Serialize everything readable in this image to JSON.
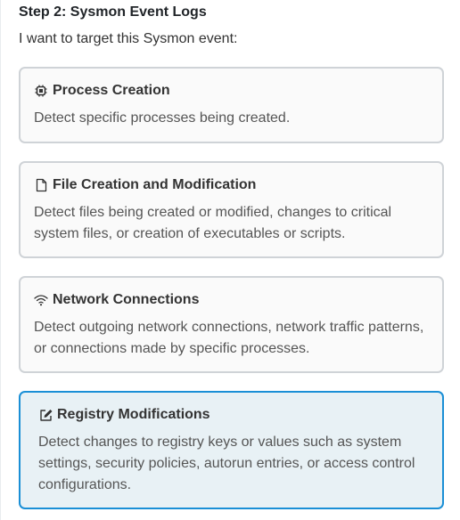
{
  "step": {
    "title": "Step 2: Sysmon Event Logs",
    "subtitle": "I want to target this Sysmon event:"
  },
  "options": [
    {
      "title": "Process Creation",
      "description": "Detect specific processes being created.",
      "icon": "cpu-icon",
      "selected": false
    },
    {
      "title": "File Creation and Modification",
      "description": "Detect files being created or modified, changes to critical system files, or creation of executables or scripts.",
      "icon": "file-icon",
      "selected": false
    },
    {
      "title": "Network Connections",
      "description": "Detect outgoing network connections, network traffic patterns, or connections made by specific processes.",
      "icon": "wifi-icon",
      "selected": false
    },
    {
      "title": "Registry Modifications",
      "description": "Detect changes to registry keys or values such as system settings, security policies, autorun entries, or access control configurations.",
      "icon": "edit-icon",
      "selected": true
    }
  ],
  "colors": {
    "selected_border": "#1a8fd6",
    "selected_background": "#e8f1f5",
    "card_border": "#cfd3d7",
    "card_background": "#fafafa"
  }
}
